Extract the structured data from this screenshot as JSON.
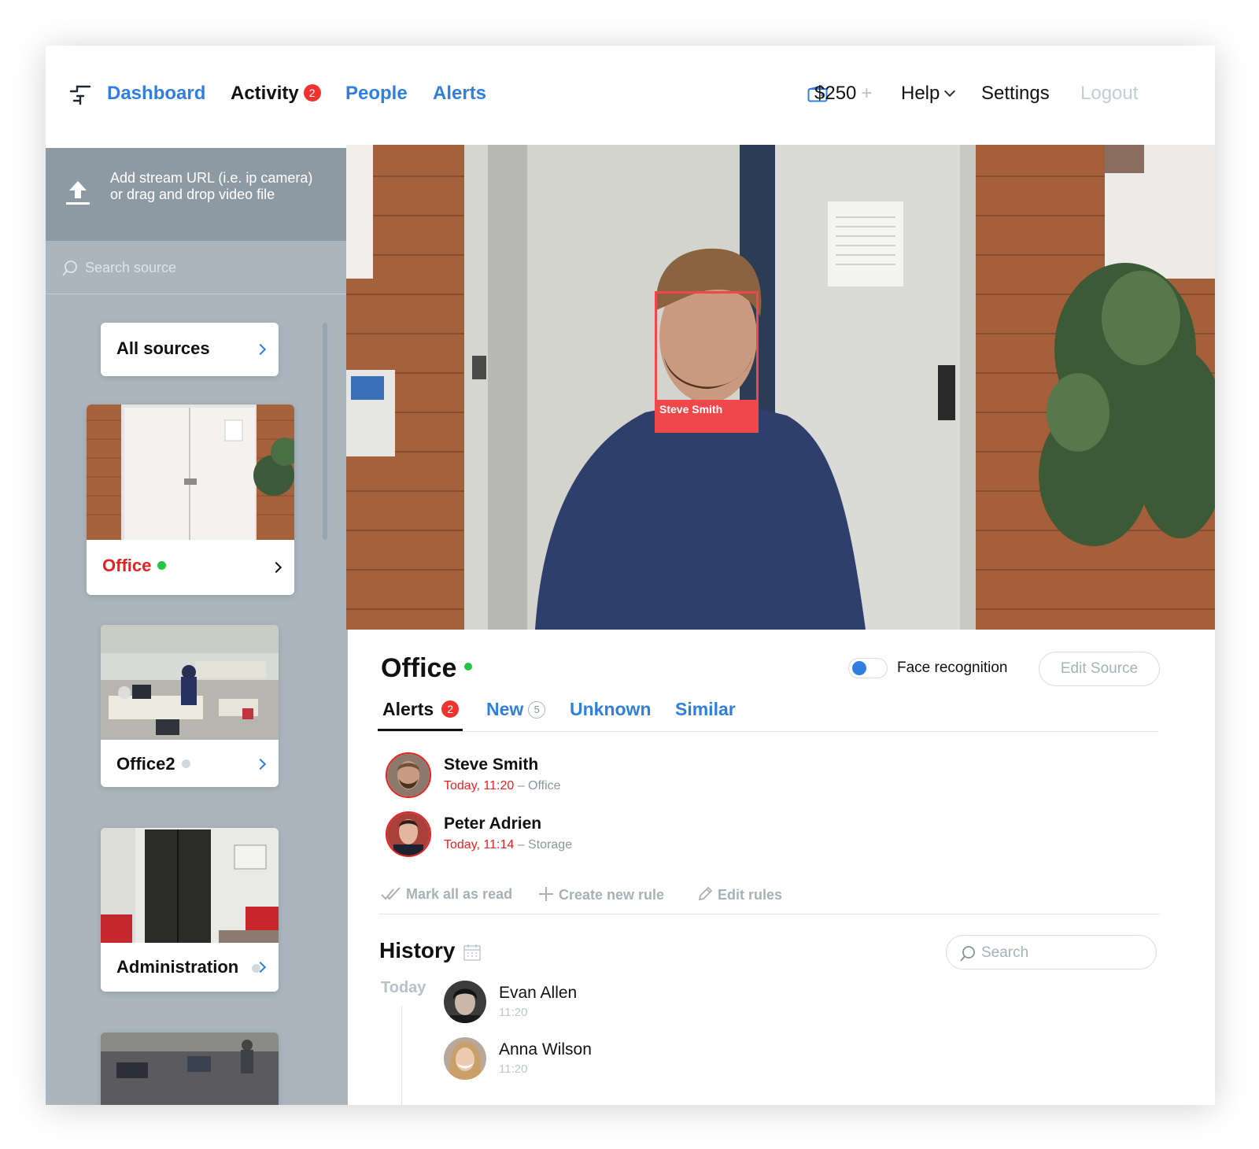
{
  "nav": {
    "logo_icon": "stairs-logo-icon",
    "links": [
      {
        "label": "Dashboard",
        "active": false
      },
      {
        "label": "Activity",
        "active": true,
        "badge": "2"
      },
      {
        "label": "People",
        "active": false
      },
      {
        "label": "Alerts",
        "active": false
      }
    ],
    "balance": "$250",
    "help_label": "Help",
    "settings_label": "Settings",
    "logout_label": "Logout"
  },
  "sidebar": {
    "upload_text": "Add stream URL (i.e. ip camera) or drag and drop video file",
    "search_placeholder": "Search source",
    "all_sources_label": "All sources",
    "sources": [
      {
        "name": "Office",
        "status": "online",
        "selected": true
      },
      {
        "name": "Office2",
        "status": "offline",
        "selected": false
      },
      {
        "name": "Administration",
        "status": "offline",
        "selected": false
      },
      {
        "name": "",
        "status": "unknown",
        "selected": false
      }
    ]
  },
  "video": {
    "face_label": "Steve Smith"
  },
  "detail": {
    "title": "Office",
    "status": "online",
    "face_recognition_label": "Face recognition",
    "face_recognition_on": true,
    "edit_source_label": "Edit Source",
    "tabs": [
      {
        "label": "Alerts",
        "badge": "2",
        "active": true
      },
      {
        "label": "New",
        "count": "5",
        "active": false
      },
      {
        "label": "Unknown",
        "active": false
      },
      {
        "label": "Similar",
        "active": false
      }
    ],
    "alerts": [
      {
        "name": "Steve Smith",
        "time": "Today, 11:20",
        "place": "– Office"
      },
      {
        "name": "Peter Adrien",
        "time": "Today, 11:14",
        "place": "– Storage"
      }
    ],
    "actions": {
      "mark_read": "Mark all as read",
      "create_rule": "Create new rule",
      "edit_rules": "Edit rules"
    },
    "history": {
      "title": "History",
      "search_placeholder": "Search",
      "day_label": "Today",
      "items": [
        {
          "name": "Evan Allen",
          "time": "11:20"
        },
        {
          "name": "Anna Wilson",
          "time": "11:20"
        }
      ]
    }
  },
  "colors": {
    "accent": "#2f7fe0",
    "alert_red": "#ea1f1f",
    "online_green": "#26c441",
    "sidebar_bg": "#aab5bd",
    "upload_bg": "#8d9aa4",
    "face_box": "#f0474a"
  }
}
